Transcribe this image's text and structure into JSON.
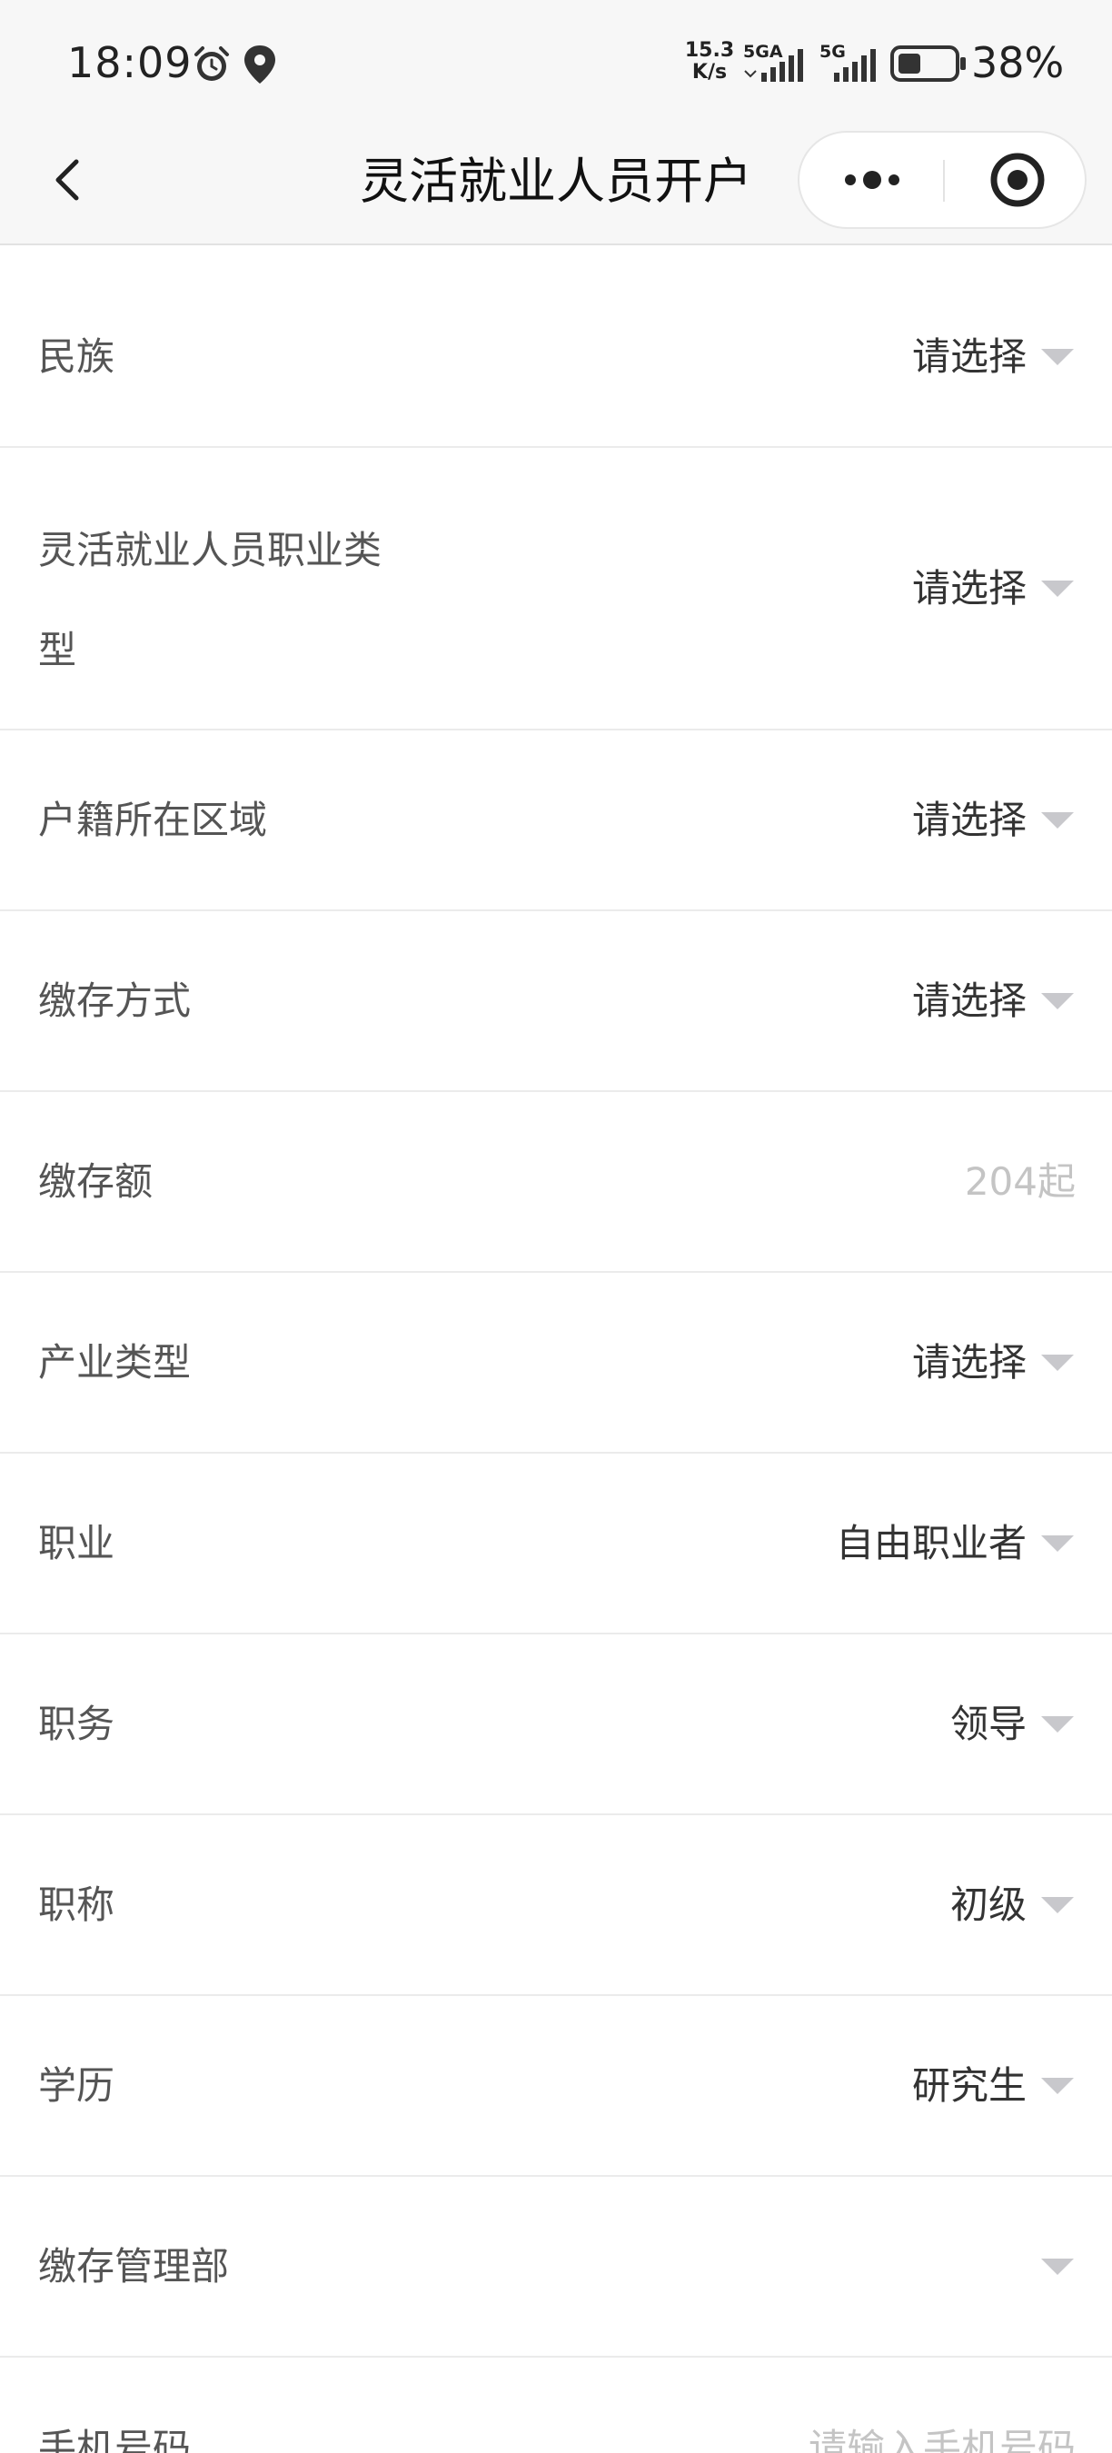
{
  "status_bar": {
    "time": "18:09",
    "net_speed_value": "15.3",
    "net_speed_unit": "K/s",
    "signal_1_label": "5GA",
    "signal_2_label": "5G",
    "battery_percent": "38%",
    "icons": [
      "alarm-icon",
      "location-icon",
      "signal-icon",
      "battery-icon"
    ]
  },
  "nav": {
    "title": "灵活就业人员开户",
    "icons": [
      "back-arrow-icon",
      "more-dots-icon",
      "close-target-icon"
    ]
  },
  "form": {
    "rows": [
      {
        "label": "民族",
        "value": "请选择"
      },
      {
        "label": "灵活就业人员职业类型",
        "value": "请选择"
      },
      {
        "label": "户籍所在区域",
        "value": "请选择"
      },
      {
        "label": "缴存方式",
        "value": "请选择"
      },
      {
        "label": "缴存额",
        "placeholder": "204起"
      },
      {
        "label": "产业类型",
        "value": "请选择"
      },
      {
        "label": "职业",
        "value": "自由职业者"
      },
      {
        "label": "职务",
        "value": "领导"
      },
      {
        "label": "职称",
        "value": "初级"
      },
      {
        "label": "学历",
        "value": "研究生"
      },
      {
        "label": "缴存管理部",
        "value": ""
      },
      {
        "label": "手机号码",
        "placeholder": "请输入手机号码"
      }
    ]
  },
  "colors": {
    "header_bg": "#f7f7f7",
    "label_text": "#555555",
    "value_text": "#333333",
    "placeholder_text": "#c4c4c4",
    "caret": "#c8c8cc",
    "divider": "#ebebeb"
  }
}
